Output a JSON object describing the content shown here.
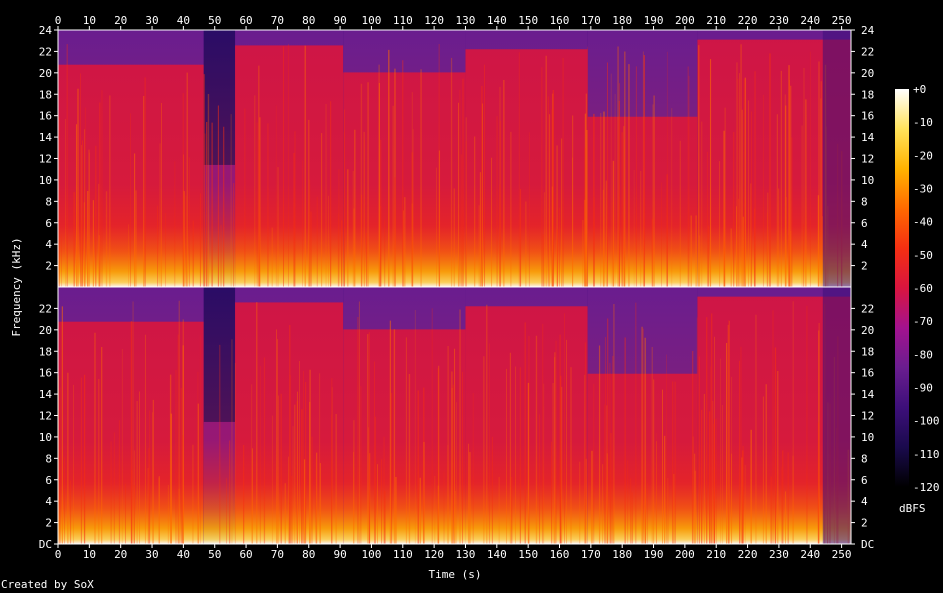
{
  "chart_data": {
    "type": "heatmap",
    "title": "",
    "xlabel": "Time (s)",
    "ylabel": "Frequency (kHz)",
    "x_ticks": [
      0,
      10,
      20,
      30,
      40,
      50,
      60,
      70,
      80,
      90,
      100,
      110,
      120,
      130,
      140,
      150,
      160,
      170,
      180,
      190,
      200,
      210,
      220,
      230,
      240,
      250
    ],
    "xlim": [
      0,
      253
    ],
    "ylim": [
      0,
      24
    ],
    "y_tick_labels": [
      "DC",
      "2",
      "4",
      "6",
      "8",
      "10",
      "12",
      "14",
      "16",
      "18",
      "20",
      "22",
      "24"
    ],
    "channels": [
      "upper",
      "lower"
    ],
    "colorbar": {
      "label": "dBFS",
      "range": [
        -120,
        0
      ],
      "ticks": [
        "+0",
        "-10",
        "-20",
        "-30",
        "-40",
        "-50",
        "-60",
        "-70",
        "-80",
        "-90",
        "-100",
        "-110",
        "-120"
      ]
    },
    "segments_time_s": [
      [
        0,
        46.5
      ],
      [
        46.5,
        56.5
      ],
      [
        56.5,
        91
      ],
      [
        91,
        130
      ],
      [
        130,
        169
      ],
      [
        169,
        204
      ],
      [
        204,
        253
      ]
    ],
    "palette": [
      "#000000",
      "#1a0a4d",
      "#3d0f7a",
      "#6a1d8f",
      "#a3128f",
      "#d9153f",
      "#f52f12",
      "#ff6a00",
      "#ffb300",
      "#ffe35c",
      "#ffffff"
    ]
  },
  "footer": {
    "credit": "Created by SoX"
  }
}
